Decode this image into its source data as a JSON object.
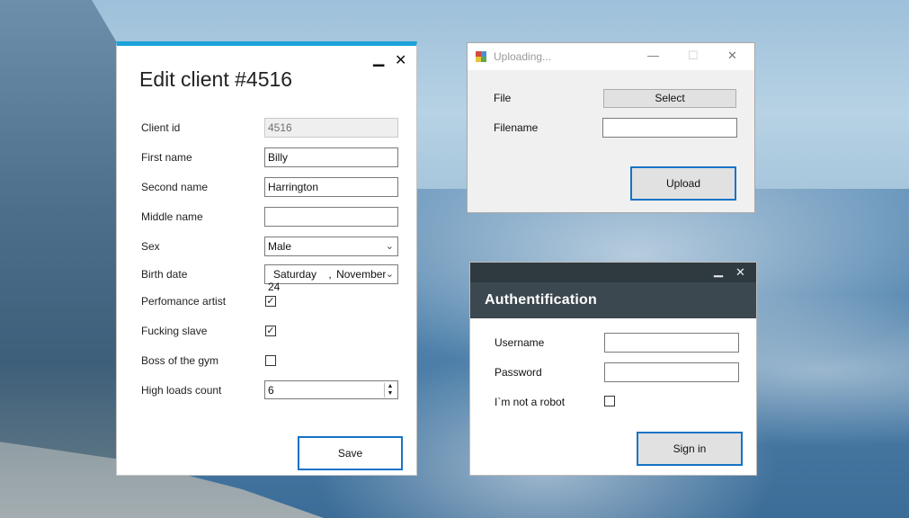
{
  "edit_window": {
    "title": "Edit client #4516",
    "minimize": "‗",
    "close": "✕",
    "fields": {
      "client_id": {
        "label": "Client id",
        "value": "4516"
      },
      "first_name": {
        "label": "First name",
        "value": "Billy"
      },
      "second_name": {
        "label": "Second name",
        "value": "Harrington"
      },
      "middle_name": {
        "label": "Middle name",
        "value": ""
      },
      "sex": {
        "label": "Sex",
        "value": "Male"
      },
      "birth_date": {
        "label": "Birth date",
        "day": "Saturday",
        "sep": ",",
        "date": "November 24"
      },
      "performance_artist": {
        "label": "Perfomance artist",
        "checked": true
      },
      "slave": {
        "label": "Fucking slave",
        "checked": true
      },
      "boss": {
        "label": "Boss of the gym",
        "checked": false
      },
      "high_loads": {
        "label": "High loads count",
        "value": "6"
      }
    },
    "save_label": "Save",
    "accent_color": "#1aa3d9"
  },
  "upload_window": {
    "title": "Uploading...",
    "file_label": "File",
    "select_label": "Select",
    "filename_label": "Filename",
    "filename_value": "",
    "upload_label": "Upload"
  },
  "auth_window": {
    "header": "Authentification",
    "username_label": "Username",
    "username_value": "",
    "password_label": "Password",
    "password_value": "",
    "robot_label": "I`m not a robot",
    "robot_checked": false,
    "signin_label": "Sign in"
  },
  "icons": [
    "minimize-icon",
    "close-icon",
    "maximize-icon",
    "chevron-down-icon",
    "checkmark-icon",
    "spin-up-icon",
    "spin-down-icon",
    "app-icon"
  ]
}
